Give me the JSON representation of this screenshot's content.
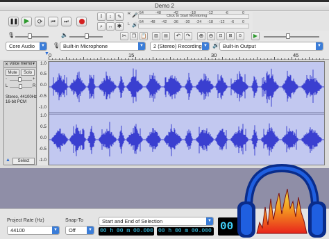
{
  "window": {
    "title": "Demo 2"
  },
  "meters": {
    "record_hint": "Click to Start Monitoring",
    "record_scale": [
      "-54",
      "-48",
      "-42",
      "-18",
      "-12",
      "-6",
      "0"
    ],
    "play_scale": [
      "-54",
      "-48",
      "-42",
      "-36",
      "-30",
      "-24",
      "-18",
      "-12",
      "-6",
      "0"
    ],
    "record_letter": "R",
    "play_letter": "L"
  },
  "device": {
    "host": "Core Audio",
    "input": "Built-in Microphone",
    "channels": "2 (Stereo) Recording...",
    "output": "Built-in Output"
  },
  "ruler": {
    "ticks": [
      "0",
      "15",
      "30",
      "45"
    ]
  },
  "track": {
    "name": "voice memo",
    "mute_label": "Mute",
    "solo_label": "Solo",
    "info_line1": "Stereo, 44100Hz",
    "info_line2": "16-bit PCM",
    "select_label": "Select",
    "gain_minus": "-",
    "gain_plus": "+",
    "pan_left": "L",
    "pan_right": "R"
  },
  "vertical_ruler": {
    "top": [
      "1.0",
      "0.5",
      "0.0",
      "-0.5",
      "-1.0"
    ],
    "bottom": [
      "1.0",
      "0.5",
      "0.0",
      "-0.5",
      "-1.0"
    ]
  },
  "selection": {
    "project_rate_label": "Project Rate (Hz)",
    "project_rate": "44100",
    "snap_label": "Snap-To",
    "snap_value": "Off",
    "mode": "Start and End of Selection",
    "start": "00 h 00 m 00.000 s",
    "end": "00 h 00 m 00.000 s",
    "big_time": "00 h"
  },
  "colors": {
    "waveform": "#3a3fd0",
    "wave_bg": "#c2c8f0",
    "empty_area": "#8f8ea7",
    "time_digits": "#3fd8ff",
    "play_green": "#2e9a2e",
    "record_red": "#d42020"
  },
  "icons": {
    "pause": "pause-icon",
    "play": "play-icon",
    "loop": "loop-icon",
    "skip_start": "skip-to-start-icon",
    "skip_end": "skip-to-end-icon",
    "record": "record-icon"
  }
}
